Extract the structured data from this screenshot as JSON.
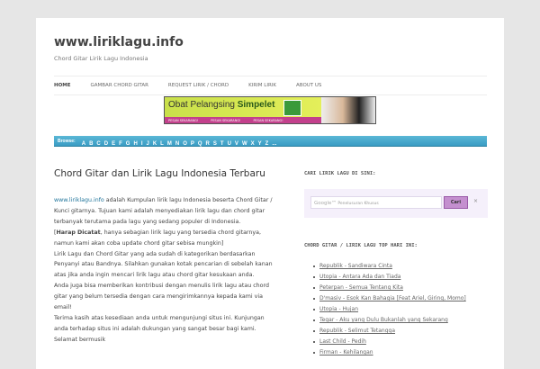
{
  "site": {
    "title": "www.liriklagu.info",
    "tagline": "Chord Gitar Lirik Lagu Indonesia"
  },
  "nav": [
    "HOME",
    "GAMBAR CHORD GITAR",
    "REQUEST LIRIK / CHORD",
    "KIRIM LIRIK",
    "ABOUT US"
  ],
  "banner": {
    "text1": "Obat Pelangsing",
    "text2": "Simpelet",
    "cta": [
      "PESAN SEKARANG!",
      "PESAN SEKARANG!",
      "PESAN SEKARANG!"
    ]
  },
  "browse": {
    "label": "Browse:",
    "letters": [
      "A",
      "B",
      "C",
      "D",
      "E",
      "F",
      "G",
      "H",
      "I",
      "J",
      "K",
      "L",
      "M",
      "N",
      "O",
      "P",
      "Q",
      "R",
      "S",
      "T",
      "U",
      "V",
      "W",
      "X",
      "Y",
      "Z",
      "..."
    ]
  },
  "main": {
    "heading": "Chord Gitar dan Lirik Lagu Indonesia Terbaru",
    "link": "www.liriklagu.info",
    "p1": " adalah Kumpulan lirik lagu Indonesia beserta Chord Gitar / Kunci gitarnya. Tujuan kami adalah menyediakan lirik lagu dan chord gitar terbanyak terutama pada lagu yang sedang populer di Indonesia.",
    "bold": "Harap Dicatat",
    "p2": ", hanya sebagian lirik lagu yang tersedia chord gitarnya, namun kami akan coba update chord gitar sebisa mungkin]",
    "p3": "Lirik Lagu dan Chord Gitar yang ada sudah di kategorikan berdasarkan Penyanyi atau Bandnya. Silahkan gunakan kotak pencarian di sebelah kanan atas jika anda ingin mencari lirik lagu atau chord gitar kesukaan anda.",
    "p4": "Anda juga bisa memberikan kontribusi dengan menulis lirik lagu atau chord gitar yang belum tersedia dengan cara mengirimkannya kepada kami via email!",
    "p5": "Terima kasih atas kesediaan anda untuk mengunjungi situs ini. Kunjungan anda terhadap situs ini adalah dukungan yang sangat besar bagi kami. Selamat bermusik"
  },
  "sidebar": {
    "search_title": "CARI LIRIK LAGU DI SINI:",
    "google": "Google™",
    "placeholder": "Penelusuran Khusus",
    "search_btn": "Cari",
    "clear": "×",
    "top_title": "CHORD GITAR / LIRIK LAGU TOP HARI INI:",
    "top": [
      "Republik - Sandiwara Cinta",
      "Utopia - Antara Ada dan Tiada",
      "Peterpan - Semua Tentang Kita",
      "D'masiv - Esok Kan Bahagia [Feat Ariel, Giring, Momo]",
      "Utopia - Hujan",
      "Tegar - Aku yang Dulu Bukanlah yang Sekarang",
      "Republik - Selimut Tetangga",
      "Last Child - Pedih",
      "Firman - Kehilangan"
    ]
  }
}
